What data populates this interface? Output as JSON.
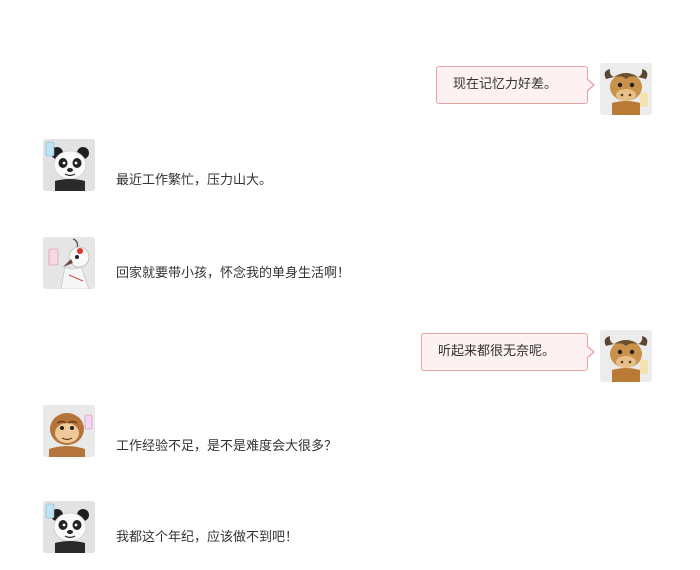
{
  "messages": [
    {
      "side": "right",
      "avatar": "bull-icon",
      "text": "现在记忆力好差。"
    },
    {
      "side": "left",
      "avatar": "panda-icon",
      "text": "最近工作繁忙，压力山大。"
    },
    {
      "side": "left",
      "avatar": "crane-icon",
      "text": "回家就要带小孩，怀念我的单身生活啊！"
    },
    {
      "side": "right",
      "avatar": "bull-icon",
      "text": "听起来都很无奈呢。"
    },
    {
      "side": "left",
      "avatar": "monkey-icon",
      "text": "工作经验不足，是不是难度会大很多？"
    },
    {
      "side": "left",
      "avatar": "panda-icon",
      "text": "我都这个年纪，应该做不到吧！"
    }
  ],
  "colors": {
    "bubble_fill": "#fdf1f1",
    "bubble_border": "#e8a3a3",
    "text": "#333333"
  }
}
